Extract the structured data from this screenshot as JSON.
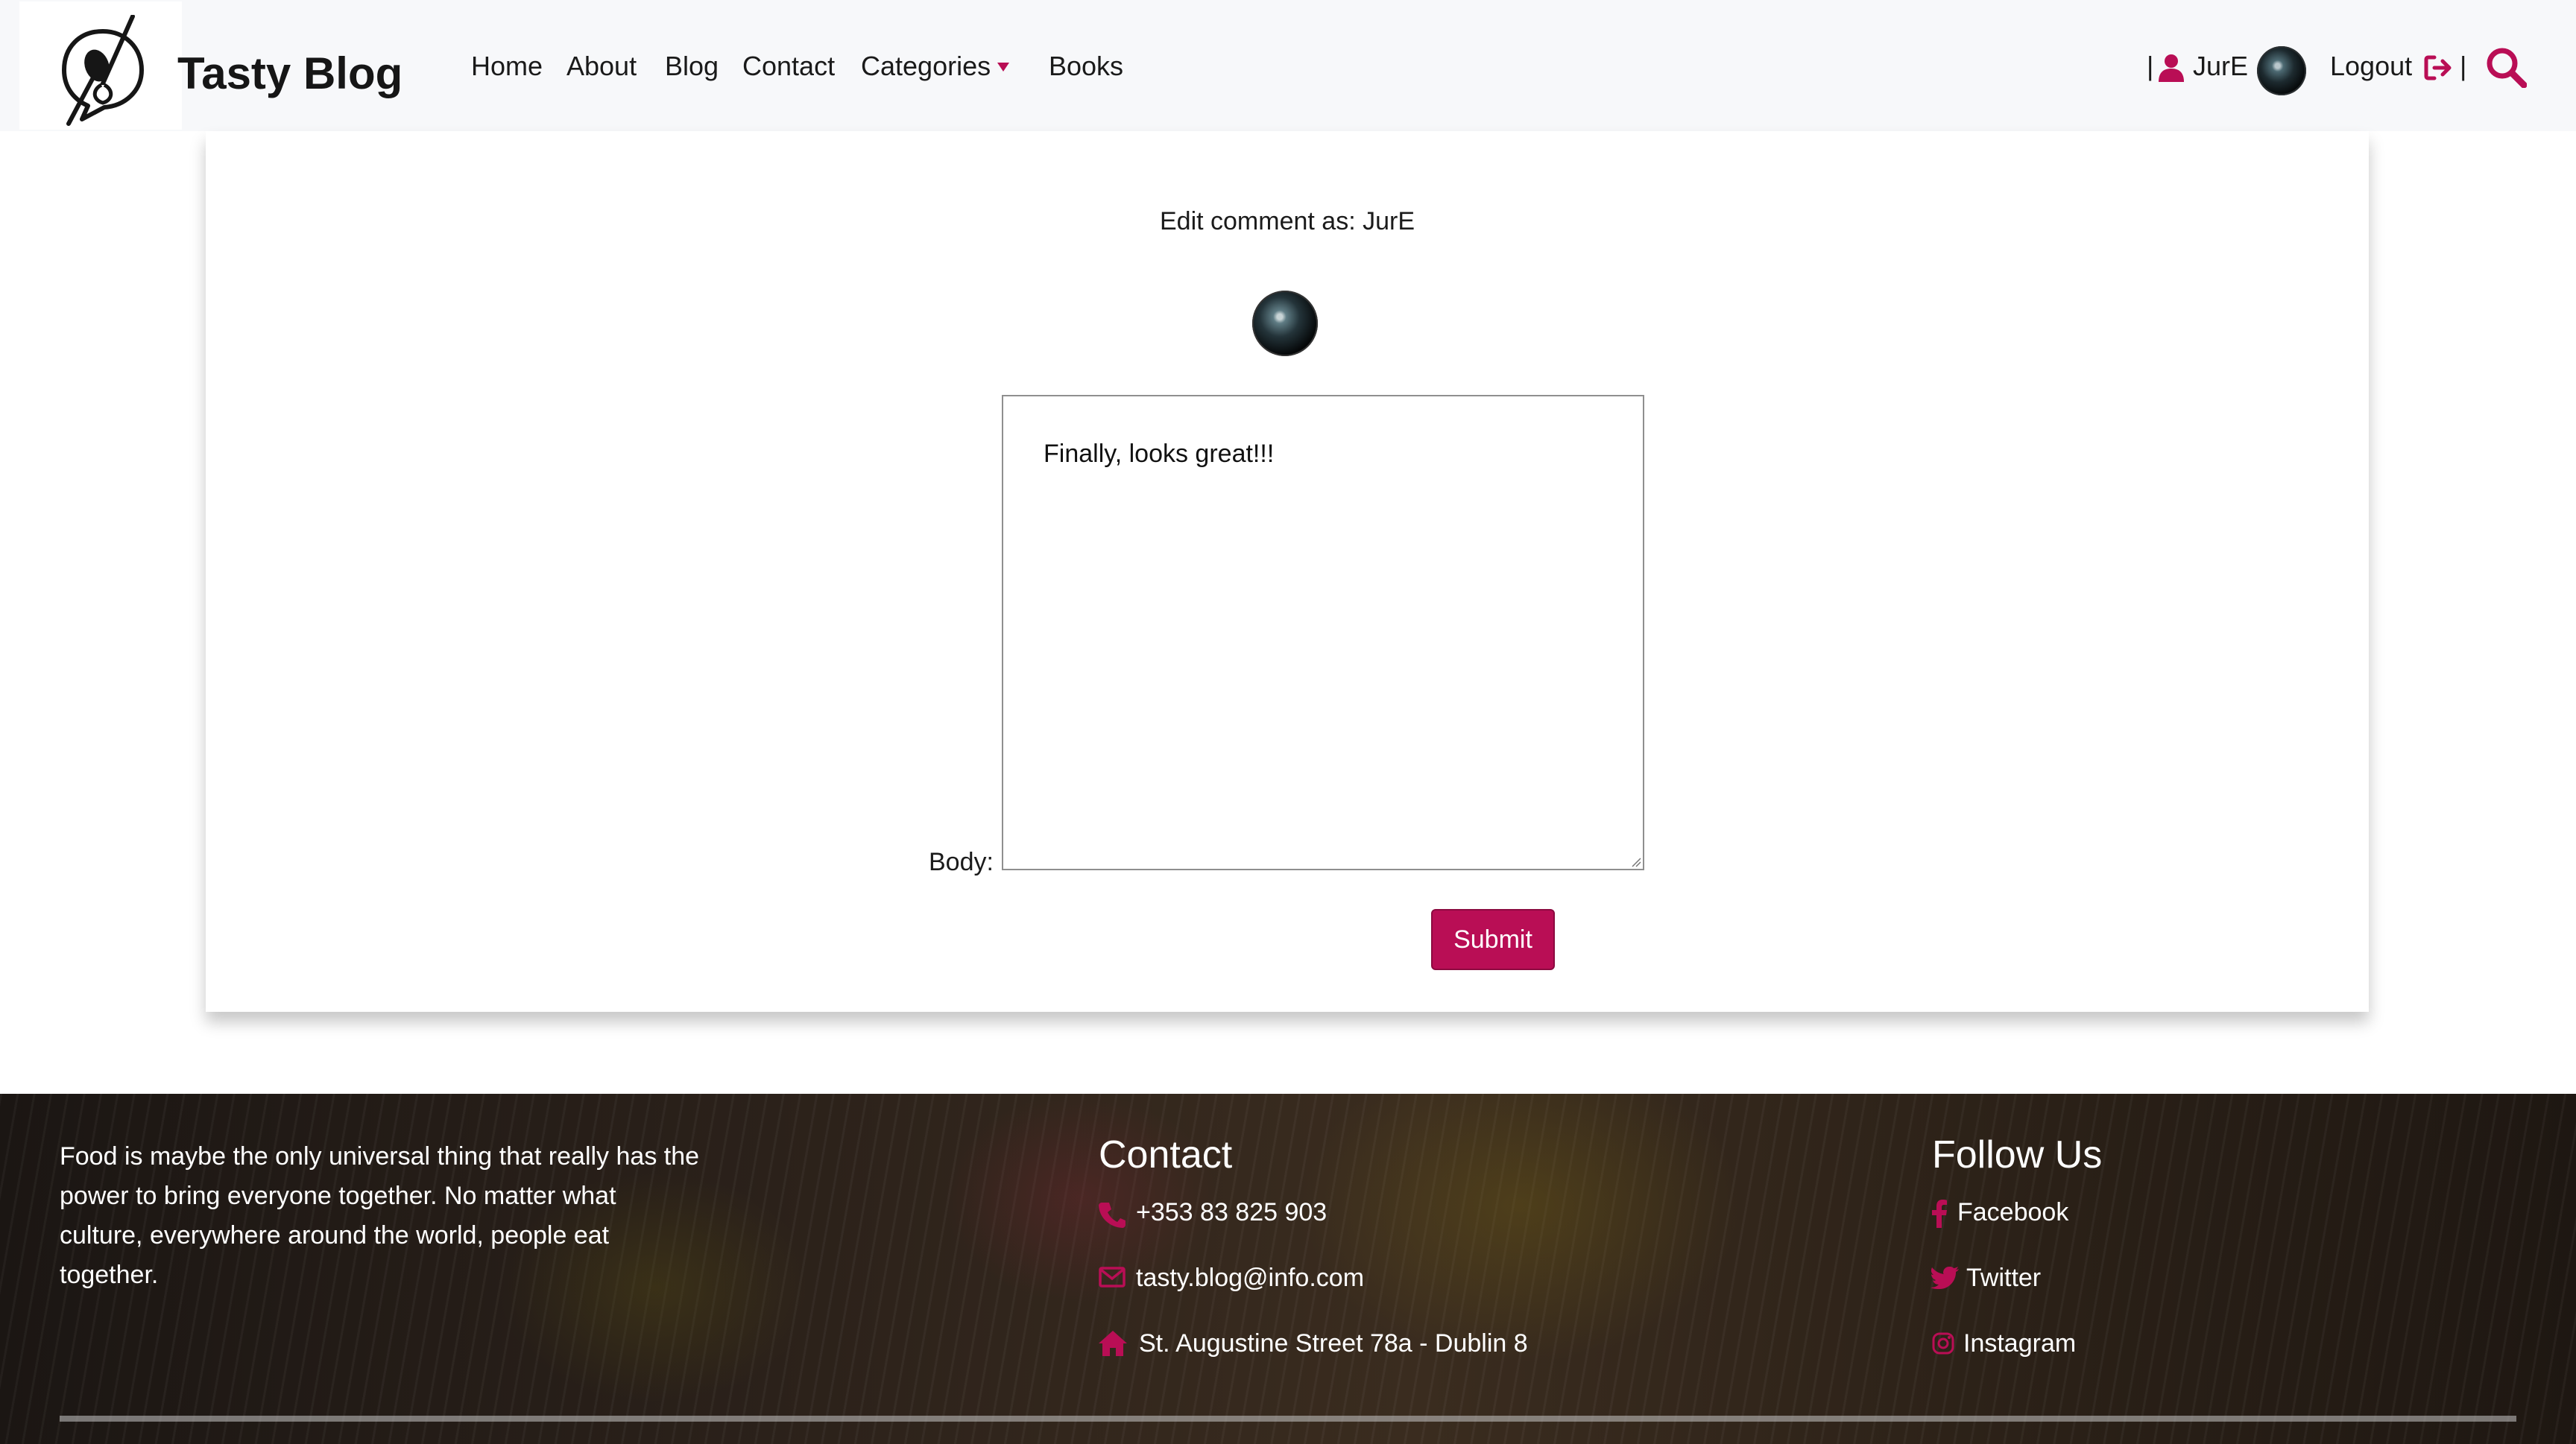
{
  "brand": {
    "name": "Tasty Blog"
  },
  "nav": {
    "links": [
      "Home",
      "About",
      "Blog",
      "Contact",
      "Categories",
      "Books"
    ],
    "pipe_left": "|",
    "username": "JurE",
    "logout": "Logout",
    "pipe_right": "|"
  },
  "form": {
    "edit_label": "Edit comment as: JurE",
    "body_label": "Body:",
    "body_value": "Finally, looks great!!!",
    "submit_label": "Submit"
  },
  "footer": {
    "about_text": "Food is maybe the only universal thing that really has the power to bring everyone together. No matter what culture, everywhere around the world, people eat together.",
    "contact": {
      "heading": "Contact",
      "phone": "+353 83 825 903",
      "email": "tasty.blog@info.com",
      "address": "St. Augustine Street 78a - Dublin 8"
    },
    "follow": {
      "heading": "Follow Us",
      "facebook": "Facebook",
      "twitter": "Twitter",
      "instagram": "Instagram"
    }
  },
  "colors": {
    "accent": "#b90e55",
    "navbar_bg": "#f7f8fa",
    "text": "#1a1a1a"
  },
  "icons": {
    "brand": "fork-spoon-chat-logo",
    "categories": "caret-down-icon",
    "user": "user-icon",
    "logout": "logout-icon",
    "search": "search-icon",
    "phone": "phone-icon",
    "email": "envelope-icon",
    "address": "home-icon",
    "facebook": "facebook-icon",
    "twitter": "twitter-icon",
    "instagram": "instagram-icon"
  }
}
